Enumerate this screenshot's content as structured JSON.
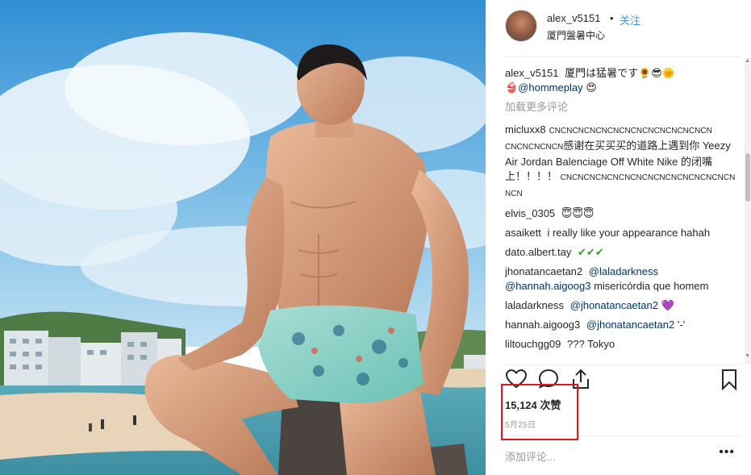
{
  "post": {
    "username": "alex_v5151",
    "separator": "•",
    "follow_label": "关注",
    "location": "厦門盤暑中心"
  },
  "caption": {
    "username": "alex_v5151",
    "text": "厦門は猛暑です🌻😎🌞",
    "line2_emoji": "👙",
    "mention": "@hommeplay",
    "end_emoji": "😍"
  },
  "load_more_label": "加载更多评论",
  "comments": [
    {
      "user": "micluxx8",
      "text_small": "CNCNCNCNCNCNCNCNCNCNCNCNCNCN",
      "text_small2": "CNCNCNCNCN",
      "text": "感谢在买买买的道路上遇到你 Yeezy Air Jordan Balenciage Off White Nike 的闭嘴",
      "text2": "上！！！！",
      "text_small3": "CNCNCNCNCNCNCNCNCNCNCNCNCNCNCN",
      "text_small4": "NCN"
    },
    {
      "user": "elvis_0305",
      "text": "😇😇😇"
    },
    {
      "user": "asaikett",
      "text": "i really like your appearance hahah"
    },
    {
      "user": "dato.albert.tay",
      "text": "✔✔✔"
    },
    {
      "user": "jhonatancaetan2",
      "mention": "@laladarkness",
      "mention2": "@hannah.aigoog3",
      "text": "misericórdia que homem"
    },
    {
      "user": "laladarkness",
      "mention": "@jhonatancaetan2",
      "text": "💜"
    },
    {
      "user": "hannah.aigoog3",
      "mention": "@jhonatancaetan2",
      "text": "'-'"
    },
    {
      "user": "liltouchgg09",
      "text": "??? Tokyo"
    }
  ],
  "likes_label": "15,124 次赞",
  "date_label": "5月25日",
  "add_comment_placeholder": "添加评论...",
  "more_options": "•••",
  "icons": {
    "like": "heart-icon",
    "comment": "comment-icon",
    "share": "share-icon",
    "save": "bookmark-icon"
  },
  "colors": {
    "link": "#3897f0",
    "mention": "#003569",
    "highlight": "#e0171f",
    "muted": "#999999"
  }
}
